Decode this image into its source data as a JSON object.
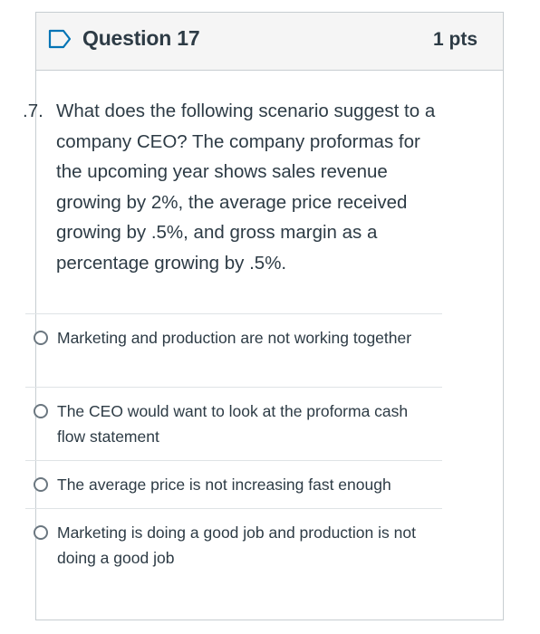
{
  "question": {
    "title": "Question 17",
    "points": "1 pts",
    "number_prefix": ".7.",
    "text": "What does the following scenario suggest to a company CEO? The company proformas for the upcoming year shows sales revenue growing by 2%, the average price received growing by .5%, and gross margin as a percentage growing by .5%."
  },
  "answers": [
    {
      "label": "Marketing and production are not working together",
      "selected": false
    },
    {
      "label": "The CEO would want to look at the proforma cash flow statement",
      "selected": false
    },
    {
      "label": "The average price is not increasing fast enough",
      "selected": false
    },
    {
      "label": "Marketing is doing a good job and production is not doing a good job",
      "selected": false
    }
  ],
  "icons": {
    "flag": "flag-outline-icon"
  },
  "colors": {
    "text": "#2d3b45",
    "header_bg": "#f5f5f5",
    "border": "#c7cdd1",
    "flag": "#0374b5"
  }
}
